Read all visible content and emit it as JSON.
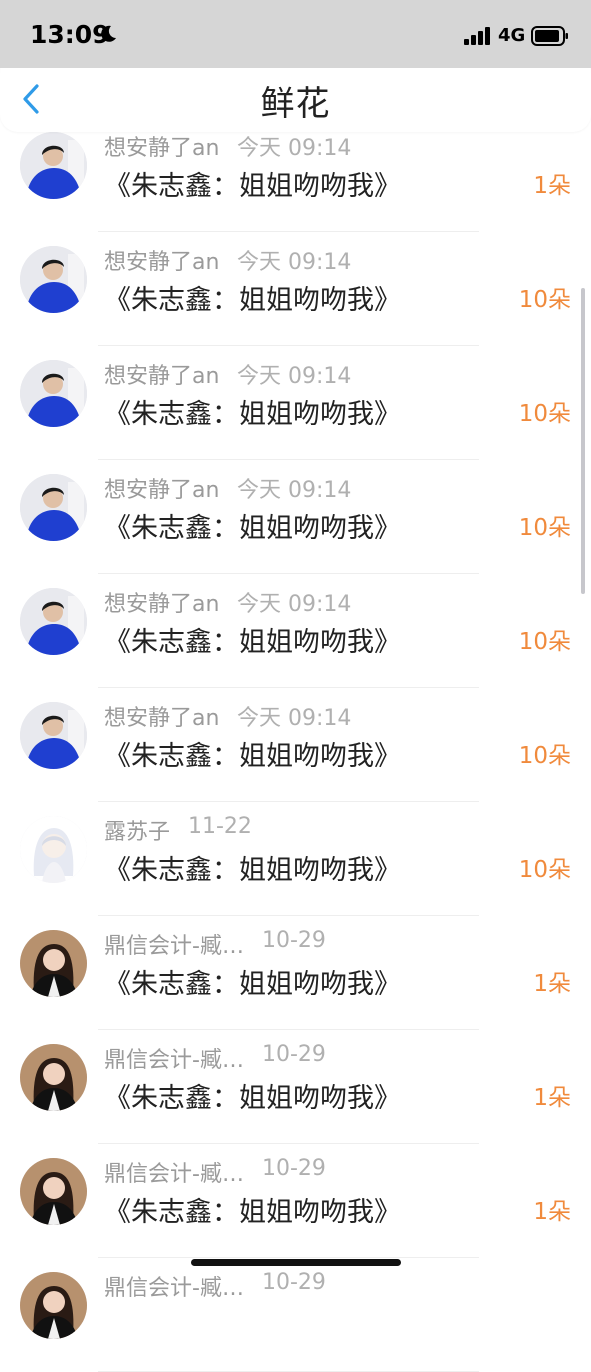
{
  "status_bar": {
    "time": "13:09",
    "network": "4G"
  },
  "header": {
    "title": "鲜花"
  },
  "rows": [
    {
      "name": "想安静了an",
      "time": "今天 09:14",
      "gift": "《朱志鑫：姐姐吻吻我》",
      "count": "1朵",
      "avatar": "blue"
    },
    {
      "name": "想安静了an",
      "time": "今天 09:14",
      "gift": "《朱志鑫：姐姐吻吻我》",
      "count": "10朵",
      "avatar": "blue"
    },
    {
      "name": "想安静了an",
      "time": "今天 09:14",
      "gift": "《朱志鑫：姐姐吻吻我》",
      "count": "10朵",
      "avatar": "blue"
    },
    {
      "name": "想安静了an",
      "time": "今天 09:14",
      "gift": "《朱志鑫：姐姐吻吻我》",
      "count": "10朵",
      "avatar": "blue"
    },
    {
      "name": "想安静了an",
      "time": "今天 09:14",
      "gift": "《朱志鑫：姐姐吻吻我》",
      "count": "10朵",
      "avatar": "blue"
    },
    {
      "name": "想安静了an",
      "time": "今天 09:14",
      "gift": "《朱志鑫：姐姐吻吻我》",
      "count": "10朵",
      "avatar": "blue"
    },
    {
      "name": "露苏子",
      "time": "11-22",
      "gift": "《朱志鑫：姐姐吻吻我》",
      "count": "10朵",
      "avatar": "anime"
    },
    {
      "name": "鼎信会计-臧…",
      "time": "10-29",
      "gift": "《朱志鑫：姐姐吻吻我》",
      "count": "1朵",
      "avatar": "woman"
    },
    {
      "name": "鼎信会计-臧…",
      "time": "10-29",
      "gift": "《朱志鑫：姐姐吻吻我》",
      "count": "1朵",
      "avatar": "woman"
    },
    {
      "name": "鼎信会计-臧…",
      "time": "10-29",
      "gift": "《朱志鑫：姐姐吻吻我》",
      "count": "1朵",
      "avatar": "woman"
    },
    {
      "name": "鼎信会计-臧…",
      "time": "10-29",
      "gift": "",
      "count": "",
      "avatar": "woman"
    }
  ]
}
